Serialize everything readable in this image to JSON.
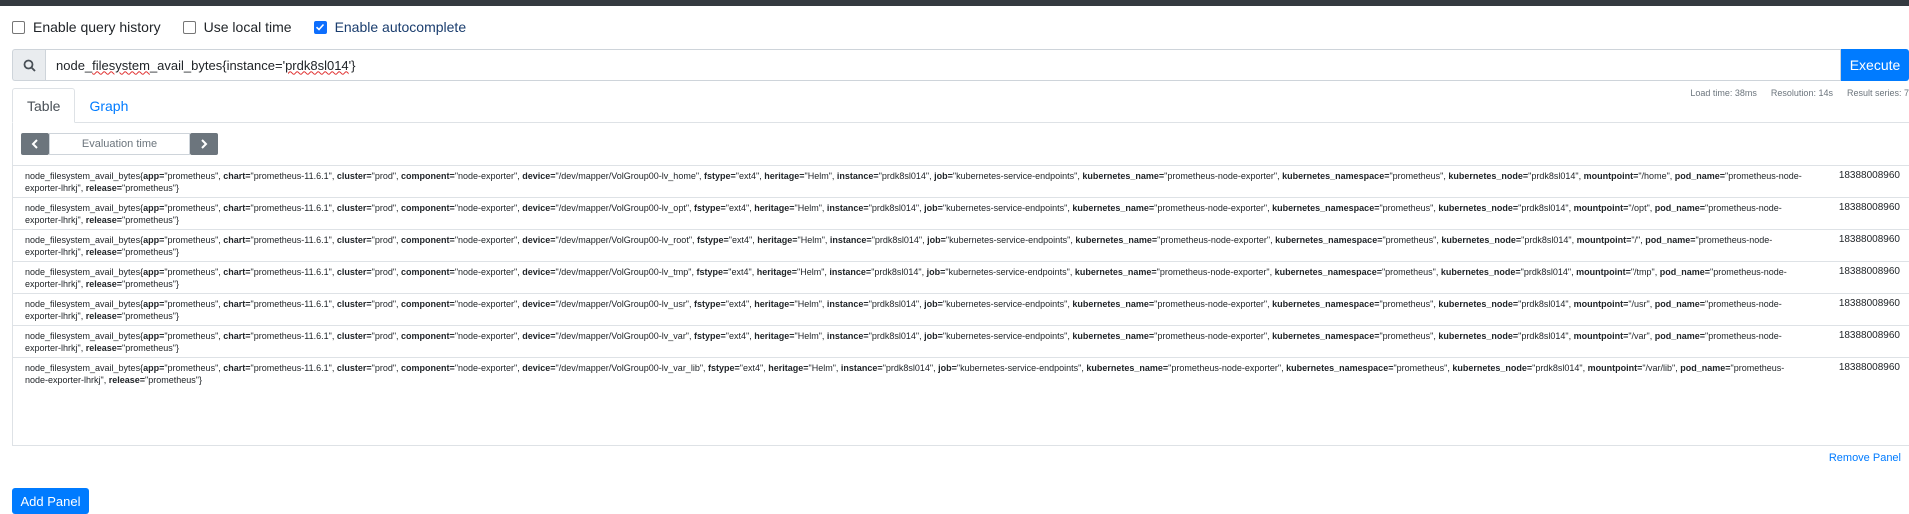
{
  "options": [
    {
      "label": "Enable query history",
      "checked": false
    },
    {
      "label": "Use local time",
      "checked": false
    },
    {
      "label": "Enable autocomplete",
      "checked": true
    }
  ],
  "query": {
    "text_prefix": "node_",
    "text_squiggle": "filesystem",
    "text_mid": "_avail_bytes{instance='",
    "text_squiggle2": "prdk8sl014",
    "text_suffix": "'}",
    "execute_label": "Execute"
  },
  "tabs": [
    {
      "label": "Table",
      "active": true
    },
    {
      "label": "Graph",
      "active": false
    }
  ],
  "stats": {
    "load_time": "Load time: 38ms",
    "resolution": "Resolution: 14s",
    "result_series": "Result series: 7"
  },
  "eval": {
    "placeholder": "Evaluation time",
    "prev_icon": "chevron-left-icon",
    "next_icon": "chevron-right-icon"
  },
  "common": {
    "metric_name": "node_filesystem_avail_bytes{",
    "app": "\"prometheus\"",
    "chart": "\"prometheus-11.6.1\"",
    "cluster": "\"prod\"",
    "component": "\"node-exporter\"",
    "fstype": "\"ext4\"",
    "heritage": "\"Helm\"",
    "instance": "\"prdk8sl014\"",
    "job": "\"kubernetes-service-endpoints\"",
    "kubernetes_name": "\"prometheus-node-exporter\"",
    "kubernetes_namespace": "\"prometheus\"",
    "kubernetes_node": "\"prdk8sl014\"",
    "pod_name": "\"prometheus-node-exporter-lhrkj\"",
    "release": "\"prometheus\"",
    "closing": "}"
  },
  "rows": [
    {
      "device": "\"/dev/mapper/VolGroup00-lv_home\"",
      "mountpoint": "\"/home\"",
      "value": "18388008960"
    },
    {
      "device": "\"/dev/mapper/VolGroup00-lv_opt\"",
      "mountpoint": "\"/opt\"",
      "value": "18388008960"
    },
    {
      "device": "\"/dev/mapper/VolGroup00-lv_root\"",
      "mountpoint": "\"/\"",
      "value": "18388008960"
    },
    {
      "device": "\"/dev/mapper/VolGroup00-lv_tmp\"",
      "mountpoint": "\"/tmp\"",
      "value": "18388008960"
    },
    {
      "device": "\"/dev/mapper/VolGroup00-lv_usr\"",
      "mountpoint": "\"/usr\"",
      "value": "18388008960"
    },
    {
      "device": "\"/dev/mapper/VolGroup00-lv_var\"",
      "mountpoint": "\"/var\"",
      "value": "18388008960"
    },
    {
      "device": "\"/dev/mapper/VolGroup00-lv_var_lib\"",
      "mountpoint": "\"/var/lib\"",
      "value": "18388008960"
    }
  ],
  "remove_panel": "Remove Panel",
  "add_panel": "Add Panel",
  "colors": {
    "accent": "#007bff",
    "topbar": "#343a40"
  }
}
